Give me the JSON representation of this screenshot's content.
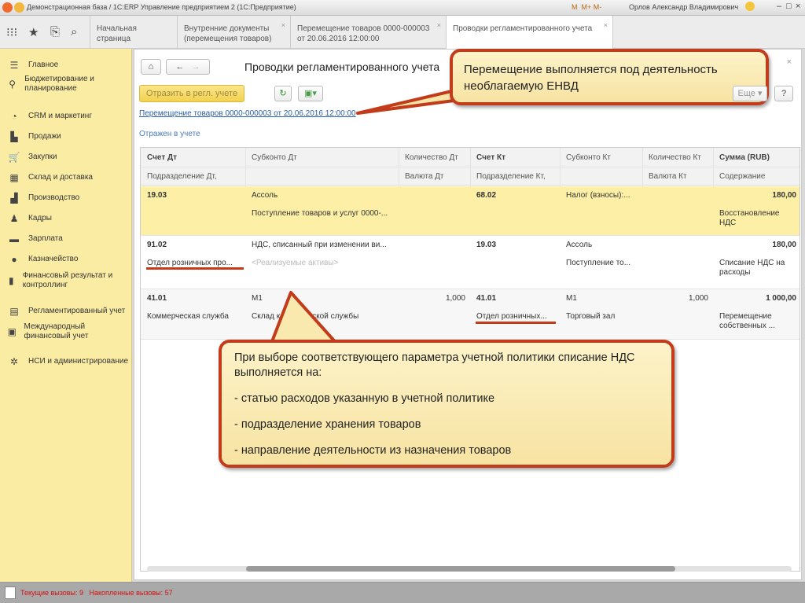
{
  "window": {
    "title": "Демонстрационная база / 1С:ERP Управление предприятием 2  (1С:Предприятие)",
    "user": "Орлов Александр Владимирович",
    "mem_buttons": [
      "M",
      "M+",
      "M-"
    ]
  },
  "tabs": [
    {
      "label": "Начальная страница",
      "closable": false
    },
    {
      "label": "Внутренние документы (перемещения товаров)",
      "closable": true
    },
    {
      "label": "Перемещение товаров 0000-000003 от 20.06.2016 12:00:00",
      "closable": true
    },
    {
      "label": "Проводки регламентированного учета",
      "closable": true,
      "active": true
    }
  ],
  "sidebar": {
    "items": [
      {
        "label": "Главное",
        "icon": "menu-icon"
      },
      {
        "label": "Бюджетирование и планирование",
        "icon": "budget-icon"
      },
      {
        "label": "CRM и маркетинг",
        "icon": "pie-chart-icon"
      },
      {
        "label": "Продажи",
        "icon": "bag-icon"
      },
      {
        "label": "Закупки",
        "icon": "cart-icon"
      },
      {
        "label": "Склад и доставка",
        "icon": "warehouse-icon"
      },
      {
        "label": "Производство",
        "icon": "factory-icon"
      },
      {
        "label": "Кадры",
        "icon": "person-icon"
      },
      {
        "label": "Зарплата",
        "icon": "card-icon"
      },
      {
        "label": "Казначейство",
        "icon": "coin-icon"
      },
      {
        "label": "Финансовый результат и контроллинг",
        "icon": "bar-chart-icon"
      },
      {
        "label": "Регламентированный учет",
        "icon": "ledger-icon"
      },
      {
        "label": "Международный финансовый учет",
        "icon": "ifrs-icon"
      },
      {
        "label": "НСИ и администрирование",
        "icon": "gear-icon"
      }
    ]
  },
  "form": {
    "title": "Проводки регламентированного учета",
    "reflect_button": "Отразить в регл. учете",
    "more_button": "Еще",
    "help_button": "?",
    "doc_link": "Перемещение товаров 0000-000003 от 20.06.2016 12:00:00",
    "status_text": "Отражен в учете"
  },
  "table": {
    "headers": [
      [
        "Счет Дт",
        "Подразделение Дт,"
      ],
      [
        "Субконто Дт",
        ""
      ],
      [
        "Количество Дт",
        "Валюта Дт"
      ],
      [
        "Счет Кт",
        "Подразделение Кт,"
      ],
      [
        "Субконто Кт",
        ""
      ],
      [
        "Количество Кт",
        "Валюта Кт"
      ],
      [
        "Сумма (RUB)",
        "Содержание"
      ]
    ],
    "rows": [
      {
        "selected": true,
        "cells": [
          [
            "19.03",
            ""
          ],
          [
            "Ассоль",
            "Поступление товаров и услуг 0000-..."
          ],
          [
            "",
            ""
          ],
          [
            "68.02",
            ""
          ],
          [
            "Налог (взносы):...",
            ""
          ],
          [
            "",
            ""
          ],
          [
            "180,00",
            "Восстановление НДС"
          ]
        ]
      },
      {
        "selected": false,
        "cells": [
          [
            "91.02",
            "Отдел розничных про..."
          ],
          [
            "НДС, списанный при изменении ви...",
            "<Реализуемые активы>"
          ],
          [
            "",
            ""
          ],
          [
            "19.03",
            ""
          ],
          [
            "Ассоль",
            "Поступление то..."
          ],
          [
            "",
            ""
          ],
          [
            "180,00",
            "Списание НДС на расходы"
          ]
        ]
      },
      {
        "selected": false,
        "cells": [
          [
            "41.01",
            "Коммерческая служба"
          ],
          [
            "М1",
            "Склад коммерческой службы"
          ],
          [
            "1,000",
            ""
          ],
          [
            "41.01",
            "Отдел розничных..."
          ],
          [
            "М1",
            "Торговый зал"
          ],
          [
            "1,000",
            ""
          ],
          [
            "1 000,00",
            "Перемещение собственных ..."
          ]
        ]
      }
    ]
  },
  "callouts": {
    "top": "Перемещение выполняется под деятельность необлагаемую ЕНВД",
    "bottom": {
      "heading": "При выборе соответствующего параметра учетной политики списание НДС выполняется на:",
      "items": [
        "- статью расходов указанную в учетной политике",
        "- подразделение хранения товаров",
        "- направление деятельности из назначения товаров"
      ]
    }
  },
  "statusbar": {
    "text": "Текущие вызовы: 9   Накопленные вызовы: 57"
  },
  "colors": {
    "accent": "#c23b1a",
    "sidebar": "#fbeca4",
    "selected_row": "#fdf0a6",
    "link": "#2a5fa8"
  }
}
